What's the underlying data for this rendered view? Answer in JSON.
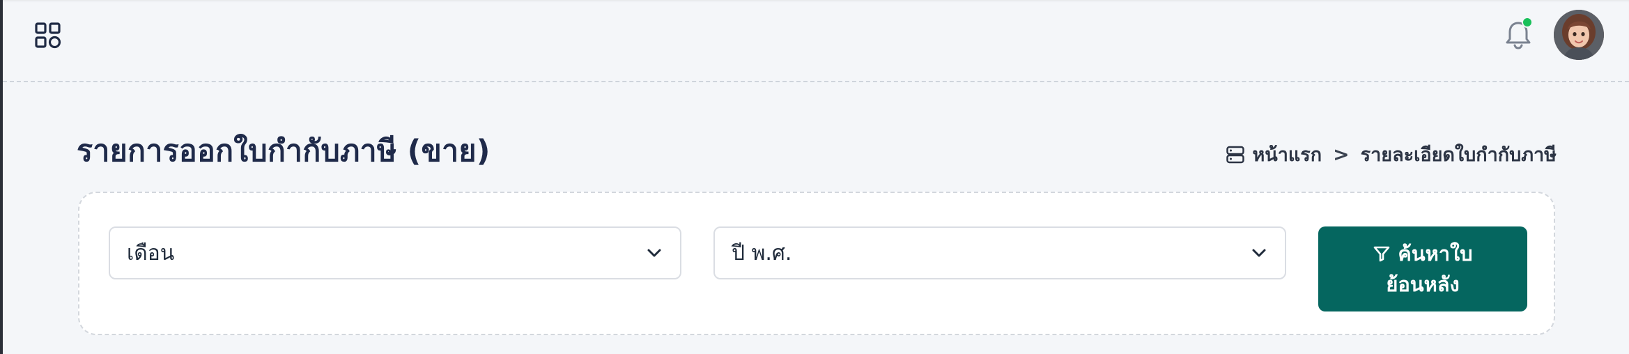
{
  "header": {
    "menu_icon": "grid-icon",
    "notification_icon": "bell-icon",
    "notification_dot_color": "#19c05a",
    "avatar_icon": "user-avatar"
  },
  "page": {
    "title": "รายการออกใบกำกับภาษี (ขาย)"
  },
  "breadcrumb": {
    "icon": "server-icon",
    "home": "หน้าแรก",
    "separator": ">",
    "current": "รายละเอียดใบกำกับภาษี"
  },
  "filters": {
    "month_placeholder": "เดือน",
    "year_placeholder": "ปี พ.ศ.",
    "search_button_line1": "ค้นหาใบ",
    "search_button_line2": "ย้อนหลัง",
    "search_icon": "filter-icon",
    "accent_color": "#05665f"
  }
}
